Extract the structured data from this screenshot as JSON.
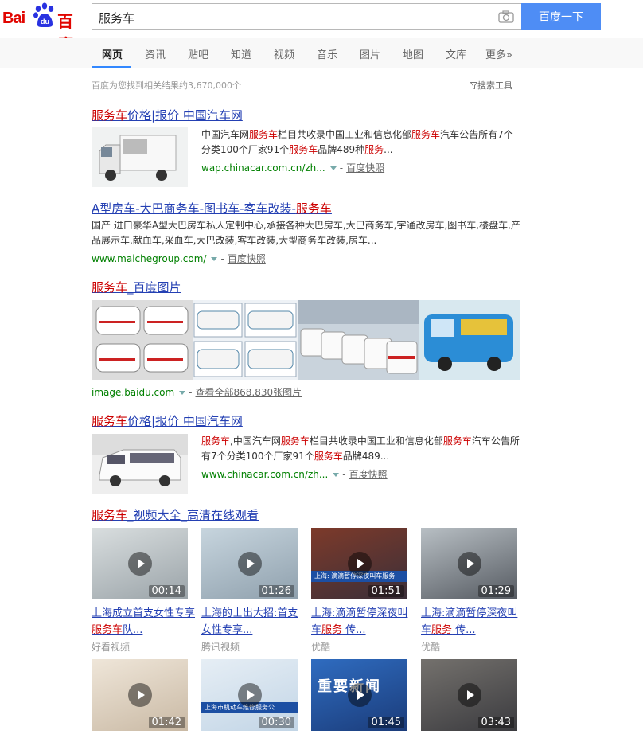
{
  "logo": {
    "latin": "Bai",
    "paw_text": "du",
    "chinese": "百度"
  },
  "search": {
    "query": "服务车",
    "button_label": "百度一下"
  },
  "tabs": [
    "网页",
    "资讯",
    "贴吧",
    "知道",
    "视频",
    "音乐",
    "图片",
    "地图",
    "文库",
    "更多»"
  ],
  "result_count": "百度为您找到相关结果约3,670,000个",
  "search_tools": "搜索工具",
  "results": [
    {
      "title_em": "服务车",
      "title_rest": "价格|报价 中国汽车网",
      "abstract": [
        {
          "t": "中国汽车网"
        },
        {
          "t": "服务车",
          "em": true
        },
        {
          "t": "栏目共收录中国工业和信息化部"
        },
        {
          "t": "服务车",
          "em": true
        },
        {
          "t": "汽车公告所有7个分类100个厂家91个"
        },
        {
          "t": "服务车",
          "em": true
        },
        {
          "t": "品牌489种"
        },
        {
          "t": "服务",
          "em": true
        },
        {
          "t": "..."
        }
      ],
      "cite": "wap.chinacar.com.cn/zh...",
      "snapshot": "百度快照"
    },
    {
      "title_pre": "A型房车-大巴商务车-图书车-客车改装-",
      "title_em": "服务车",
      "abstract": "国产 进口豪华A型大巴房车私人定制中心,承接各种大巴房车,大巴商务车,宇通改房车,图书车,楼盘车,产品展示车,献血车,采血车,大巴改装,客车改装,大型商务车改装,房车...",
      "cite": "www.maichegroup.com/",
      "snapshot": "百度快照"
    },
    {
      "title_em": "服务车",
      "title_rest": "_百度图片",
      "cite": "image.baidu.com",
      "more": "查看全部868,830张图片"
    },
    {
      "title_em": "服务车",
      "title_rest": "价格|报价 中国汽车网",
      "abstract": [
        {
          "t": "服务车",
          "em": true
        },
        {
          "t": ",中国汽车网"
        },
        {
          "t": "服务车",
          "em": true
        },
        {
          "t": "栏目共收录中国工业和信息化部"
        },
        {
          "t": "服务车",
          "em": true
        },
        {
          "t": "汽车公告所有7个分类100个厂家91个"
        },
        {
          "t": "服务车",
          "em": true
        },
        {
          "t": "品牌489..."
        }
      ],
      "cite": "www.chinacar.com.cn/zh...",
      "snapshot": "百度快照"
    },
    {
      "title_em": "服务车",
      "title_rest": "_视频大全_高清在线观看"
    }
  ],
  "videos": [
    {
      "duration": "00:14",
      "title_pre": "上海成立首支女性专享",
      "title_em": "服务车",
      "title_post": "队...",
      "source": "好看视频",
      "thumb_overlay": ""
    },
    {
      "duration": "01:26",
      "title_pre": "上海的士出大招:首支女性专享...",
      "title_em": "",
      "title_post": "",
      "source": "腾讯视频",
      "thumb_overlay": ""
    },
    {
      "duration": "01:51",
      "title_pre": "上海:滴滴暂停深夜叫车",
      "title_em": "服务",
      "title_post": " 传...",
      "source": "优酷",
      "thumb_overlay": "上海: 滴滴暂停深夜叫车服务"
    },
    {
      "duration": "01:29",
      "title_pre": "上海:滴滴暂停深夜叫车",
      "title_em": "服务",
      "title_post": " 传...",
      "source": "优酷",
      "thumb_overlay": ""
    },
    {
      "duration": "01:42",
      "title_pre": "",
      "title_em": "",
      "title_post": "",
      "source": "",
      "thumb_overlay": ""
    },
    {
      "duration": "00:30",
      "title_pre": "",
      "title_em": "",
      "title_post": "",
      "source": "",
      "thumb_overlay": "上海市机动车维修服务公"
    },
    {
      "duration": "01:45",
      "title_pre": "",
      "title_em": "",
      "title_post": "",
      "source": "",
      "thumb_overlay": "重要新闻"
    },
    {
      "duration": "03:43",
      "title_pre": "",
      "title_em": "",
      "title_post": "",
      "source": "",
      "thumb_overlay": ""
    }
  ]
}
